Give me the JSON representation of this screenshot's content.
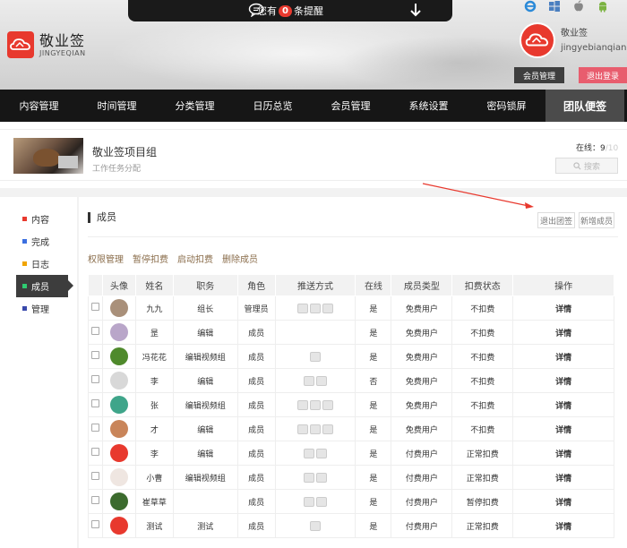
{
  "header": {
    "notice_prefix": "您有",
    "notice_count": "0",
    "notice_suffix": "条提醒",
    "logo_cn": "敬业签",
    "logo_en": "JINGYEQIAN",
    "platforms": [
      "ie-icon",
      "windows-icon",
      "apple-icon",
      "android-icon"
    ],
    "user_name": "敬业签",
    "user_account": "jingyebianqian",
    "member_btn": "会员管理",
    "logout_btn": "退出登录"
  },
  "nav": [
    "内容管理",
    "时间管理",
    "分类管理",
    "日历总览",
    "会员管理",
    "系统设置",
    "密码锁屏",
    "团队便签"
  ],
  "team": {
    "name": "敬业签项目组",
    "desc": "工作任务分配",
    "online_label": "在线：",
    "online_current": "9",
    "online_total": "/10",
    "search_placeholder": "搜索"
  },
  "sidebar": [
    {
      "label": "内容",
      "color": "#e8392e"
    },
    {
      "label": "完成",
      "color": "#3b6fe0"
    },
    {
      "label": "日志",
      "color": "#f0a400"
    },
    {
      "label": "成员",
      "color": "#2ecc71"
    },
    {
      "label": "管理",
      "color": "#3949ab"
    }
  ],
  "main": {
    "section_title": "成员",
    "exit_team": "退出团签",
    "add_member": "新增成员",
    "actions": [
      "权限管理",
      "暂停扣费",
      "启动扣费",
      "删除成员"
    ]
  },
  "table": {
    "headers": [
      "",
      "头像",
      "姓名",
      "职务",
      "角色",
      "推送方式",
      "在线",
      "成员类型",
      "扣费状态",
      "操作"
    ],
    "rows": [
      {
        "name": "九九",
        "title": "组长",
        "role": "管理员",
        "push": 3,
        "online": "是",
        "type": "免费用户",
        "fee": "不扣费",
        "op": "详情",
        "avatar": "#a9907a"
      },
      {
        "name": "昰",
        "title": "编辑",
        "role": "成员",
        "push": 0,
        "online": "是",
        "type": "免费用户",
        "fee": "不扣费",
        "op": "详情",
        "avatar": "#b9a6c9"
      },
      {
        "name": "冯花花",
        "title": "编辑视频组",
        "role": "成员",
        "push": 1,
        "online": "是",
        "type": "免费用户",
        "fee": "不扣费",
        "op": "详情",
        "avatar": "#4f8a2c"
      },
      {
        "name": "李",
        "title": "编辑",
        "role": "成员",
        "push": 2,
        "online": "否",
        "type": "免费用户",
        "fee": "不扣费",
        "op": "详情",
        "avatar": "#d8d8d8"
      },
      {
        "name": "张",
        "title": "编辑视频组",
        "role": "成员",
        "push": 3,
        "online": "是",
        "type": "免费用户",
        "fee": "不扣费",
        "op": "详情",
        "avatar": "#3fa58a"
      },
      {
        "name": "才",
        "title": "编辑",
        "role": "成员",
        "push": 3,
        "online": "是",
        "type": "免费用户",
        "fee": "不扣费",
        "op": "详情",
        "avatar": "#c9855a"
      },
      {
        "name": "李",
        "title": "编辑",
        "role": "成员",
        "push": 2,
        "online": "是",
        "type": "付费用户",
        "fee": "正常扣费",
        "op": "详情",
        "avatar": "#e8392e"
      },
      {
        "name": "小曹",
        "title": "编辑视频组",
        "role": "成员",
        "push": 2,
        "online": "是",
        "type": "付费用户",
        "fee": "正常扣费",
        "op": "详情",
        "avatar": "#efe6e1"
      },
      {
        "name": "崔草草",
        "title": "",
        "role": "成员",
        "push": 2,
        "online": "是",
        "type": "付费用户",
        "fee": "暂停扣费",
        "op": "详情",
        "avatar": "#3c6b2e"
      },
      {
        "name": "测试",
        "title": "测试",
        "role": "成员",
        "push": 1,
        "online": "是",
        "type": "付费用户",
        "fee": "正常扣费",
        "op": "详情",
        "avatar": "#e8392e"
      }
    ]
  }
}
